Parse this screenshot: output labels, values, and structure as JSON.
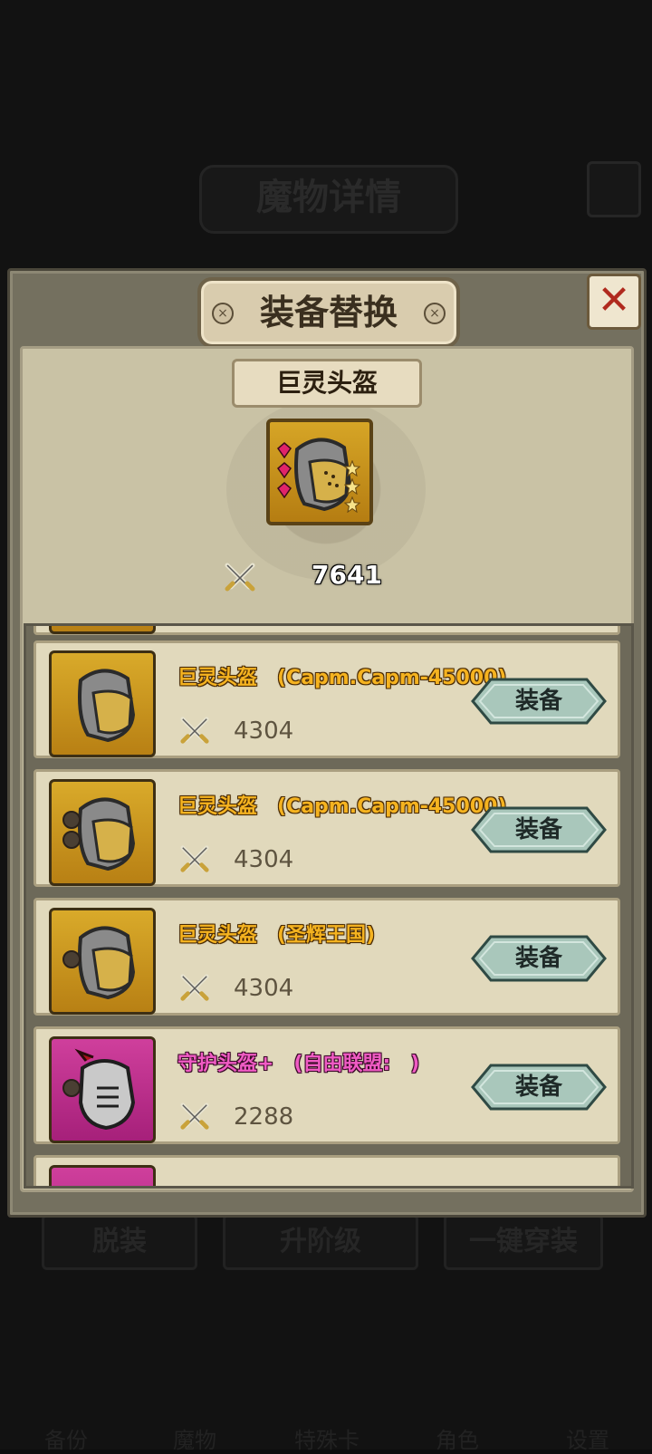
{
  "background": {
    "title": "魔物详情",
    "buttons": [
      "脱装",
      "升阶级",
      "一键穿装"
    ],
    "nav": [
      "备份",
      "魔物",
      "特殊卡",
      "角色",
      "设置"
    ]
  },
  "dialog": {
    "title": "装备替换",
    "current_item": {
      "name": "巨灵头盔",
      "power": "7641",
      "gems": 3,
      "stars": 3
    },
    "list": [
      {
        "name": "巨灵头盔　(Capm.Capm-45000)",
        "power": "4304",
        "rarity": "gold",
        "sockets": 0,
        "button": "装备"
      },
      {
        "name": "巨灵头盔　(Capm.Capm-45000)",
        "power": "4304",
        "rarity": "gold",
        "sockets": 2,
        "button": "装备"
      },
      {
        "name": "巨灵头盔　(圣辉王国)",
        "power": "4304",
        "rarity": "gold",
        "sockets": 1,
        "button": "装备"
      },
      {
        "name": "守护头盔+　(自由联盟:　)",
        "power": "2288",
        "rarity": "magenta",
        "sockets": 1,
        "button": "装备"
      }
    ]
  },
  "colors": {
    "gold_name": "#f5b320",
    "magenta_name": "#f05bc4",
    "button": "#a9c7bb"
  },
  "icons": {
    "close": "close-x-icon",
    "power": "crossed-swords-icon",
    "item": "helmet-icon"
  }
}
